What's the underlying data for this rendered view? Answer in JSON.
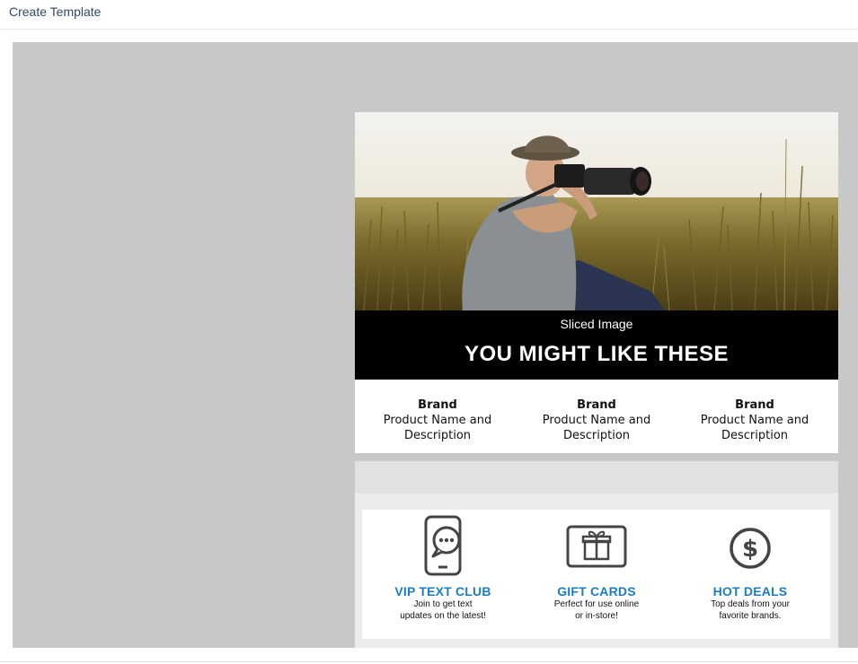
{
  "header": {
    "title": "Create Template"
  },
  "email": {
    "banner": {
      "subtitle": "Sliced Image",
      "title": "YOU MIGHT LIKE THESE"
    },
    "products": [
      {
        "brand": "Brand",
        "name": "Product Name and Description"
      },
      {
        "brand": "Brand",
        "name": "Product Name and Description"
      },
      {
        "brand": "Brand",
        "name": "Product Name and Description"
      }
    ],
    "promos": [
      {
        "icon": "phone-chat-icon",
        "title": "VIP TEXT CLUB",
        "line1": "Join to get text",
        "line2": "updates on the latest!"
      },
      {
        "icon": "gift-card-icon",
        "title": "GIFT CARDS",
        "line1": "Perfect for use online",
        "line2": "or in-store!"
      },
      {
        "icon": "dollar-circle-icon",
        "title": "HOT DEALS",
        "line1": "Top deals from your",
        "line2": "favorite brands."
      }
    ]
  },
  "colors": {
    "canvas_bg": "#c8c8c8",
    "promo_title": "#1a7dc4",
    "banner_bg": "#000000"
  }
}
